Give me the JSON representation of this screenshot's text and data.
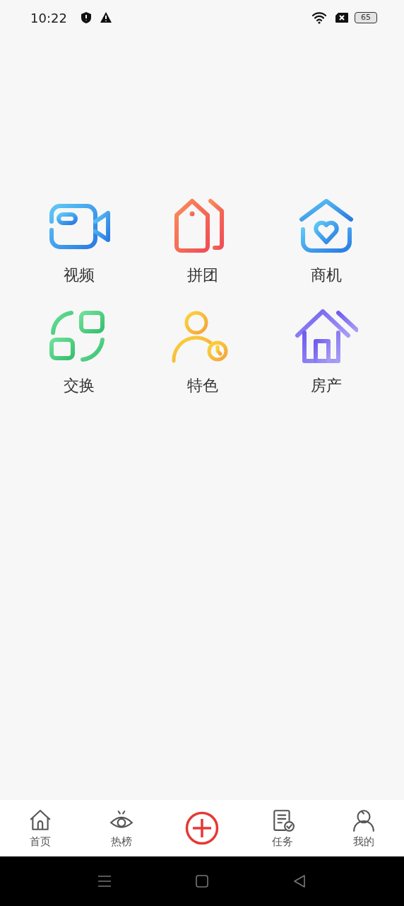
{
  "status_bar": {
    "time": "10:22",
    "battery": "65"
  },
  "grid": [
    {
      "label": "视频"
    },
    {
      "label": "拼团"
    },
    {
      "label": "商机"
    },
    {
      "label": "交换"
    },
    {
      "label": "特色"
    },
    {
      "label": "房产"
    }
  ],
  "tab_bar": [
    {
      "kind": "tab",
      "label": "首页"
    },
    {
      "kind": "tab",
      "label": "热榜"
    },
    {
      "kind": "plus"
    },
    {
      "kind": "tab",
      "label": "任务"
    },
    {
      "kind": "tab",
      "label": "我的"
    }
  ]
}
